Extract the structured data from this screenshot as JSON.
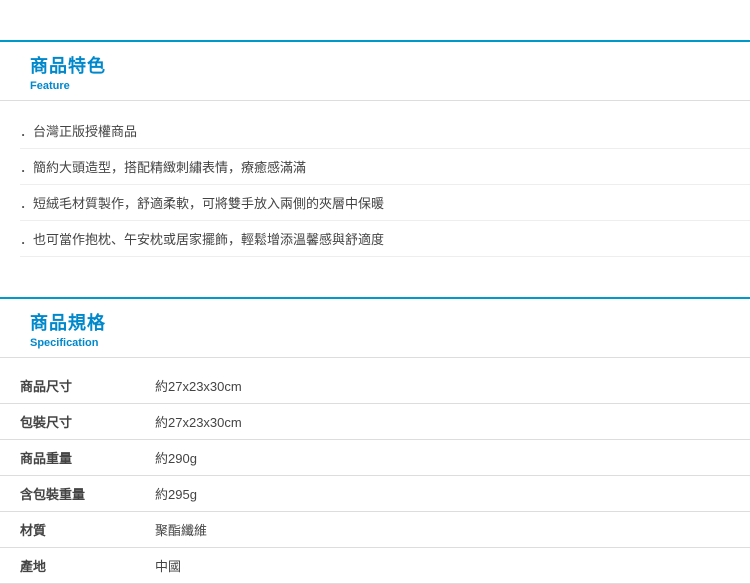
{
  "feature": {
    "title_zh": "商品特色",
    "title_en": "Feature",
    "items": [
      "台灣正版授權商品",
      "簡約大頭造型，搭配精緻刺繡表情，療癒感滿滿",
      "短絨毛材質製作，舒適柔軟，可將雙手放入兩側的夾層中保暖",
      "也可當作抱枕、午安枕或居家擺飾，輕鬆增添溫馨感與舒適度"
    ]
  },
  "specification": {
    "title_zh": "商品規格",
    "title_en": "Specification",
    "rows": [
      {
        "label": "商品尺寸",
        "value": "約27x23x30cm"
      },
      {
        "label": "包裝尺寸",
        "value": "約27x23x30cm"
      },
      {
        "label": "商品重量",
        "value": "約290g"
      },
      {
        "label": "含包裝重量",
        "value": "約295g"
      },
      {
        "label": "材質",
        "value": "聚酯纖維"
      },
      {
        "label": "產地",
        "value": "中國"
      }
    ]
  }
}
